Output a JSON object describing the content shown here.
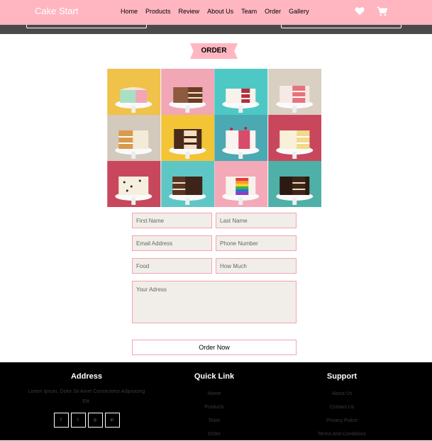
{
  "brand": "Cake Start",
  "nav": [
    "Home",
    "Products",
    "Review",
    "About Us",
    "Team",
    "Order",
    "Gallery"
  ],
  "icons": [
    "heart-icon",
    "cart-icon"
  ],
  "section_title": "ORDER",
  "form": {
    "first_name": "First Name",
    "last_name": "Last Name",
    "email": "Email Address",
    "phone": "Phone Number",
    "food": "Food",
    "how_much": "How Much",
    "address": "Your Adress",
    "submit": "Order Now"
  },
  "footer": {
    "address_title": "Address",
    "address_text": "Lorem Ipsum, Dolor Sit Amet Consectetur Adipisicing Elit.",
    "socials": [
      "f",
      "t",
      "◎",
      "in"
    ],
    "quick_title": "Quick Link",
    "quick_links": [
      "Home",
      "Products",
      "Team",
      "Order"
    ],
    "support_title": "Support",
    "support_links": [
      "About Us",
      "Contact Us",
      "Privacy Police",
      "Terms And Conditions"
    ]
  },
  "colors": {
    "accent": "#ffb6c1",
    "field_bg": "#f1eee9",
    "field_border": "#f4a3b2",
    "footer_bg": "#000000"
  }
}
